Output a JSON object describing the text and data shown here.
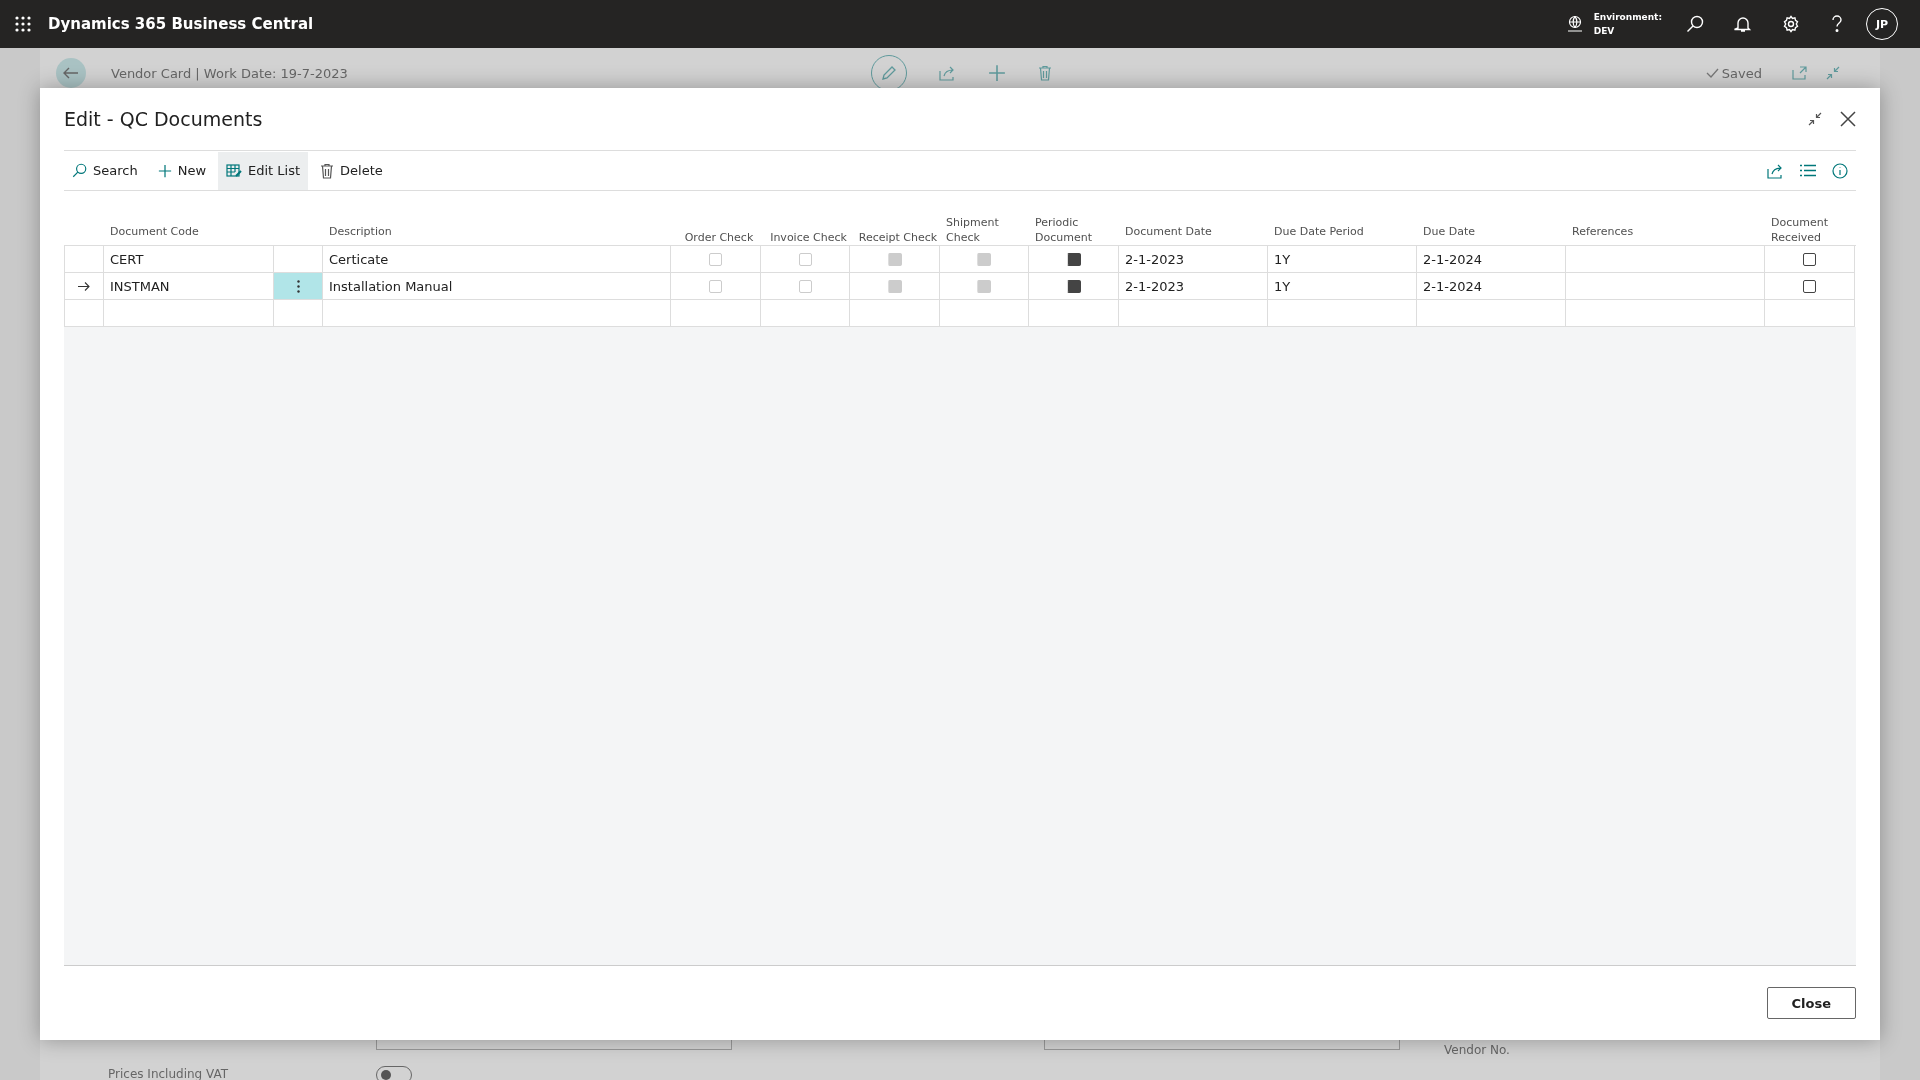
{
  "app": {
    "title": "Dynamics 365 Business Central",
    "environment_label": "Environment:",
    "environment": "DEV",
    "avatar": "JP"
  },
  "page": {
    "title": "Vendor Card | Work Date: 19-7-2023",
    "status": "Saved",
    "fields": [
      {
        "kind": "text"
      },
      {
        "kind": "text"
      },
      {
        "label": "Vendor No.",
        "kind": "label"
      },
      {
        "label": "Prices Including VAT",
        "kind": "toggle",
        "on": false
      }
    ]
  },
  "dialog": {
    "title": "Edit - QC Documents",
    "actions": [
      {
        "label": "Search",
        "kind": "search",
        "selected": false
      },
      {
        "label": "New",
        "kind": "new",
        "selected": false
      },
      {
        "label": "Edit List",
        "kind": "editlist",
        "selected": true
      },
      {
        "label": "Delete",
        "kind": "delete",
        "selected": false
      }
    ],
    "table": {
      "columns": [
        {
          "label": "Document Code",
          "kind": "text"
        },
        {
          "kind": "menu"
        },
        {
          "label": "Description",
          "kind": "text"
        },
        {
          "label": "Order Check",
          "kind": "check"
        },
        {
          "label": "Invoice Check",
          "kind": "check"
        },
        {
          "label": "Receipt Check",
          "kind": "check"
        },
        {
          "label": "Shipment Check",
          "kind": "check"
        },
        {
          "label": "Periodic Document",
          "kind": "check"
        },
        {
          "label": "Document Date",
          "kind": "text"
        },
        {
          "label": "Due Date Period",
          "kind": "text"
        },
        {
          "label": "Due Date",
          "kind": "text"
        },
        {
          "label": "References",
          "kind": "text"
        },
        {
          "label": "Document Received",
          "kind": "check"
        }
      ],
      "rows": [
        {
          "selected": false,
          "cells": [
            "CERT",
            null,
            "Certicate",
            {
              "checked": false,
              "disabled": true
            },
            {
              "checked": false,
              "disabled": true
            },
            {
              "checked": true,
              "disabled": true
            },
            {
              "checked": true,
              "disabled": true
            },
            {
              "checked": true,
              "disabled": false
            },
            "2-1-2023",
            "1Y",
            "2-1-2024",
            null,
            {
              "checked": false,
              "disabled": false
            }
          ]
        },
        {
          "selected": true,
          "cells": [
            "INSTMAN",
            null,
            "Installation Manual",
            {
              "checked": false,
              "disabled": true
            },
            {
              "checked": false,
              "disabled": true
            },
            {
              "checked": true,
              "disabled": true
            },
            {
              "checked": true,
              "disabled": true
            },
            {
              "checked": true,
              "disabled": false
            },
            "2-1-2023",
            "1Y",
            "2-1-2024",
            null,
            {
              "checked": false,
              "disabled": false
            }
          ]
        }
      ]
    },
    "close_button": "Close"
  }
}
